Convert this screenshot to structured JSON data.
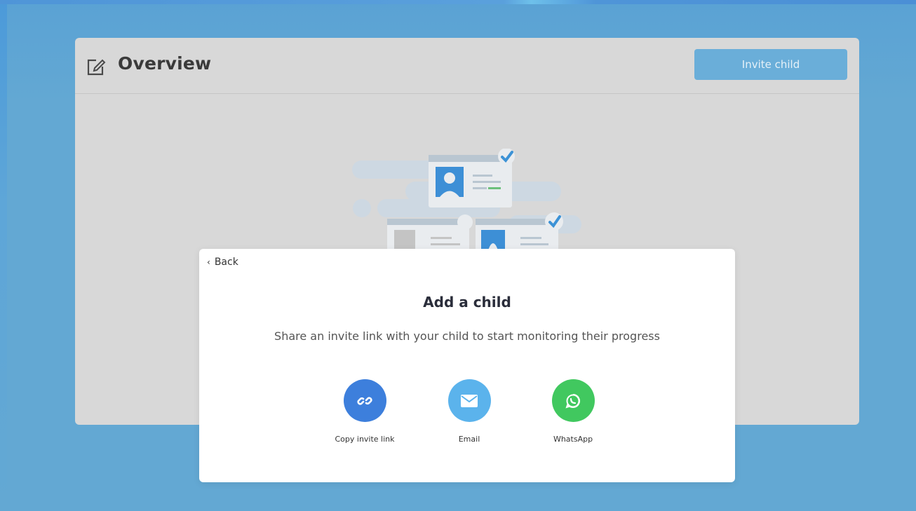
{
  "overview": {
    "title": "Overview",
    "invite_button_label": "Invite child"
  },
  "modal": {
    "back_label": "Back",
    "title": "Add a child",
    "subtitle": "Share an invite link with your child to start monitoring their progress",
    "options": [
      {
        "label": "Copy invite link",
        "icon": "link-icon",
        "color": "#3d7fdc"
      },
      {
        "label": "Email",
        "icon": "envelope-icon",
        "color": "#5bb3ec"
      },
      {
        "label": "WhatsApp",
        "icon": "whatsapp-icon",
        "color": "#41c85f"
      }
    ]
  },
  "colors": {
    "background": "#63a8d3",
    "panel": "#d8d8d8",
    "invite_button": "#6aaed9",
    "check_accent": "#3c92d6"
  }
}
